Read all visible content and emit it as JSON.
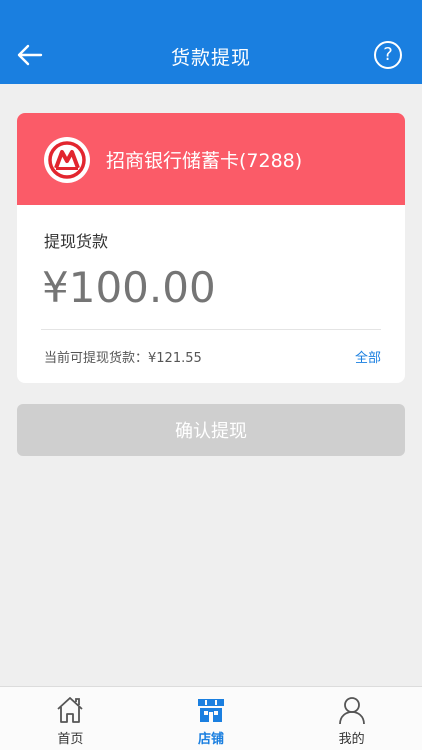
{
  "header": {
    "title": "货款提现"
  },
  "bank_card": {
    "name": "招商银行储蓄卡(7288)",
    "logo_icon": "cmb-bank-logo-icon",
    "color": "#fb5b68"
  },
  "withdraw": {
    "label": "提现货款",
    "amount_placeholder": "¥100.00",
    "available_text": "当前可提现货款：¥121.55",
    "all_label": "全部"
  },
  "confirm": {
    "label": "确认提现"
  },
  "tabbar": {
    "items": [
      {
        "label": "首页",
        "icon": "home-icon",
        "active": false
      },
      {
        "label": "店铺",
        "icon": "store-icon",
        "active": true
      },
      {
        "label": "我的",
        "icon": "user-icon",
        "active": false
      }
    ]
  },
  "colors": {
    "primary": "#1a7fe0",
    "bank_card": "#fb5b68",
    "disabled_button": "#cfcfcf",
    "background": "#efefef"
  }
}
